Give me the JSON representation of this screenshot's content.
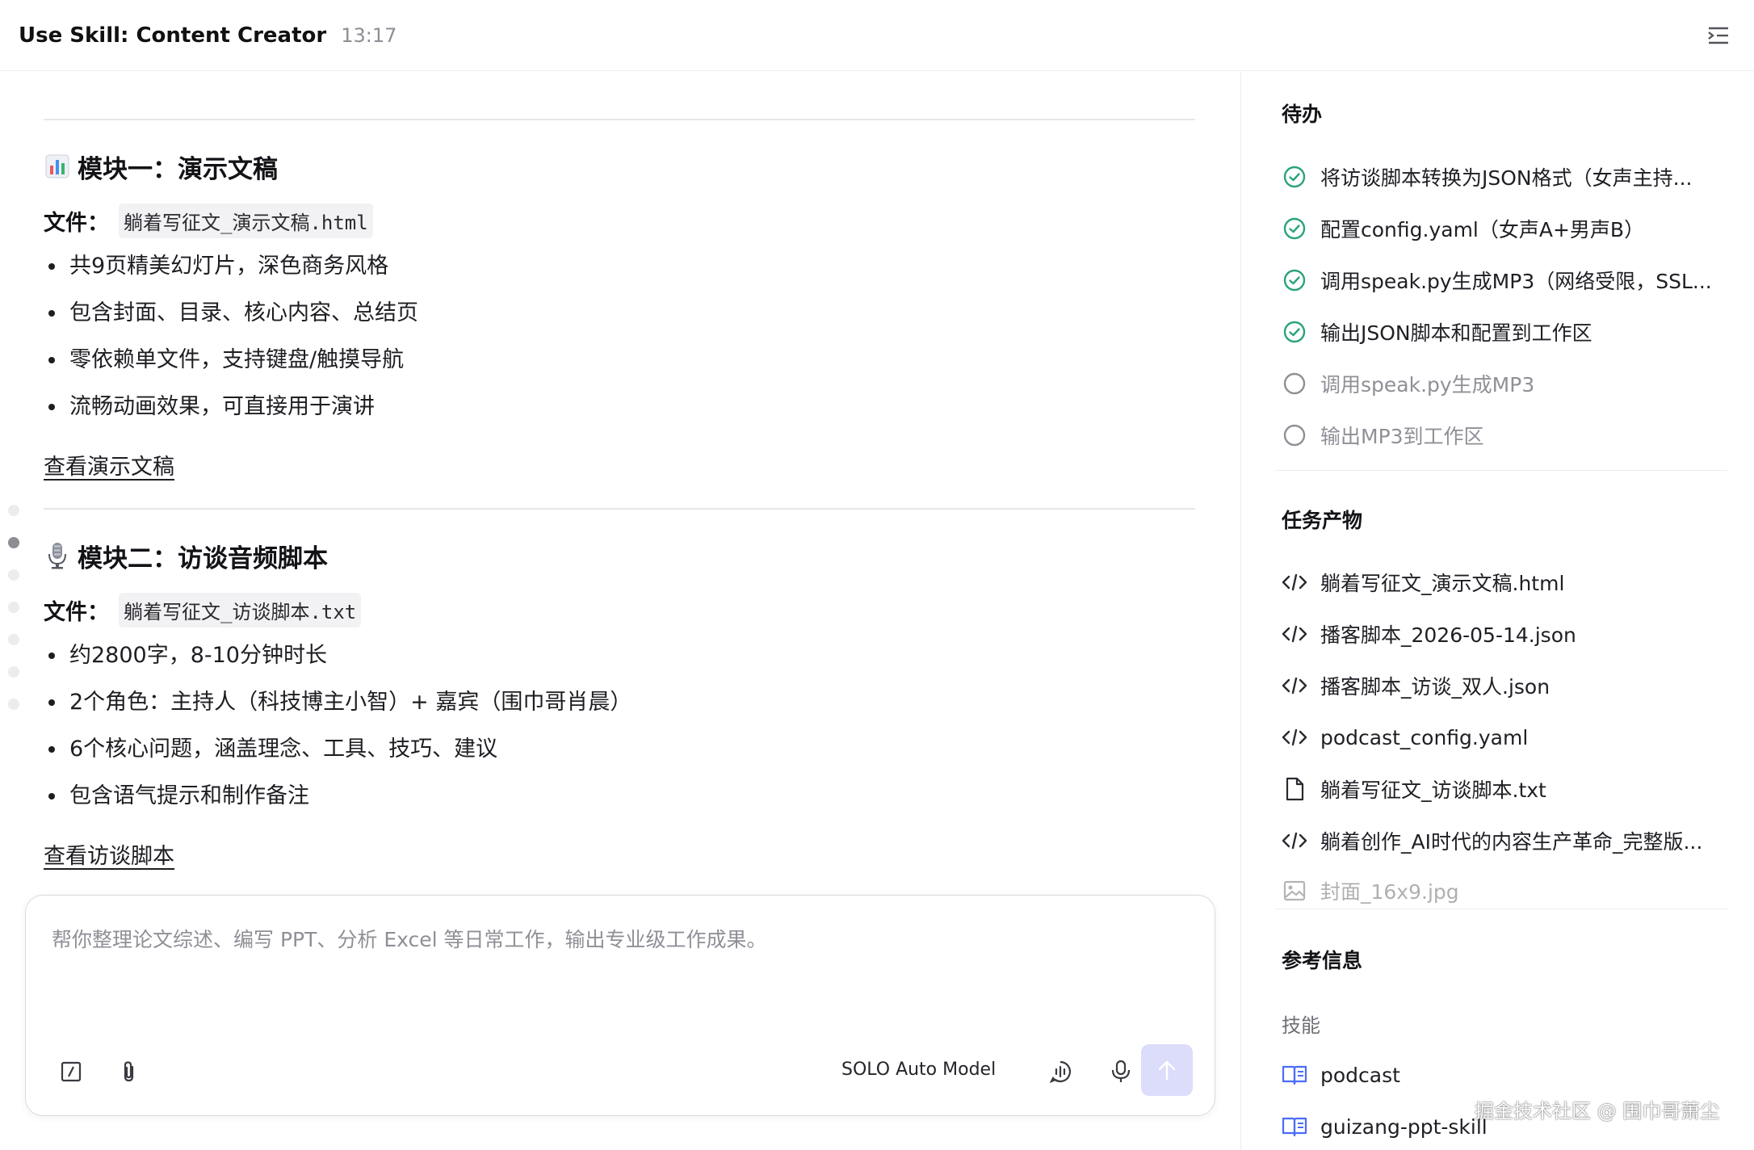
{
  "header": {
    "title": "Use Skill: Content Creator",
    "time": "13:17"
  },
  "module1": {
    "title": "模块一：演示文稿",
    "file_label": "文件：",
    "file_name": "躺着写征文_演示文稿.html",
    "bullets": [
      "共9页精美幻灯片，深色商务风格",
      "包含封面、目录、核心内容、总结页",
      "零依赖单文件，支持键盘/触摸导航",
      "流畅动画效果，可直接用于演讲"
    ],
    "link": "查看演示文稿"
  },
  "module2": {
    "title": "模块二：访谈音频脚本",
    "file_label": "文件：",
    "file_name": "躺着写征文_访谈脚本.txt",
    "bullets": [
      "约2800字，8-10分钟时长",
      "2个角色：主持人（科技博主小智）+ 嘉宾（围巾哥肖晨）",
      "6个核心问题，涵盖理念、工具、技巧、建议",
      "包含语气提示和制作备注"
    ],
    "link": "查看访谈脚本"
  },
  "input": {
    "placeholder": "帮你整理论文综述、编写 PPT、分析 Excel 等日常工作，输出专业级工作成果。",
    "model": "SOLO Auto Model"
  },
  "sidebar": {
    "todo_title": "待办",
    "todos": [
      {
        "label": "将访谈脚本转换为JSON格式（女声主持...",
        "done": true
      },
      {
        "label": "配置config.yaml（女声A+男声B）",
        "done": true
      },
      {
        "label": "调用speak.py生成MP3（网络受限，SSL...",
        "done": true
      },
      {
        "label": "输出JSON脚本和配置到工作区",
        "done": true
      },
      {
        "label": "调用speak.py生成MP3",
        "done": false
      },
      {
        "label": "输出MP3到工作区",
        "done": false
      }
    ],
    "products_title": "任务产物",
    "products": [
      {
        "label": "躺着写征文_演示文稿.html",
        "icon": "code-icon"
      },
      {
        "label": "播客脚本_2026-05-14.json",
        "icon": "code-icon"
      },
      {
        "label": "播客脚本_访谈_双人.json",
        "icon": "code-icon"
      },
      {
        "label": "podcast_config.yaml",
        "icon": "code-icon"
      },
      {
        "label": "躺着写征文_访谈脚本.txt",
        "icon": "file-icon"
      },
      {
        "label": "躺着创作_AI时代的内容生产革命_完整版...",
        "icon": "code-icon"
      },
      {
        "label": "封面_16x9.jpg",
        "icon": "image-icon"
      }
    ],
    "ref_title": "参考信息",
    "skills_label": "技能",
    "skills": [
      "podcast",
      "guizang-ppt-skill"
    ]
  },
  "watermark": "掘金技术社区 @ 围巾哥萧尘",
  "colors": {
    "check": "#2aa37a",
    "accent": "#4a6cf7",
    "send_bg": "#dcdcfb"
  }
}
